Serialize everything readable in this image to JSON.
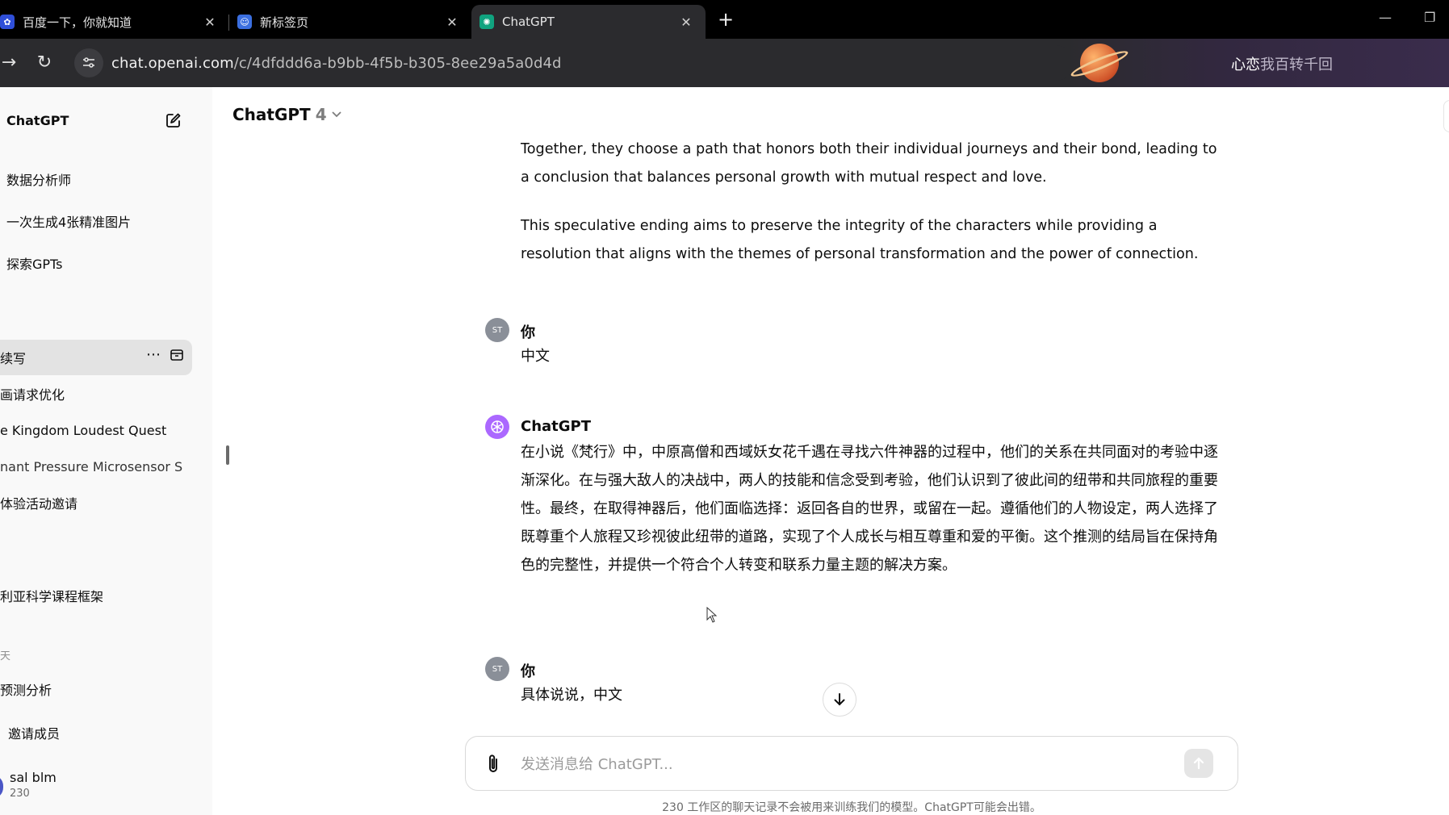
{
  "browser": {
    "tabs": [
      {
        "title": "百度一下，你就知道",
        "icon": "baidu-paw-icon"
      },
      {
        "title": "新标签页",
        "icon": "new-tab-icon"
      },
      {
        "title": "ChatGPT",
        "icon": "chatgpt-logo-icon",
        "active": true
      }
    ],
    "new_tab_label": "+",
    "url_host": "chat.openai.com",
    "url_path": "/c/4dfddd6a-b9bb-4f5b-b305-8ee29a5a0d4d",
    "banner_motto_a": "心恋",
    "banner_motto_b": "我百转千回"
  },
  "sidebar": {
    "title": "ChatGPT",
    "gpts": [
      {
        "label": "数据分析师"
      },
      {
        "label": "一次生成4张精准图片"
      },
      {
        "label": "探索GPTs"
      }
    ],
    "conversations": [
      {
        "label": "续写",
        "active": true
      },
      {
        "label": "画请求优化"
      },
      {
        "label": "e Kingdom Loudest Quest"
      },
      {
        "label": "nant Pressure Microsensor S"
      },
      {
        "label": "体验活动邀请"
      },
      {
        "label": "利亚科学课程框架"
      }
    ],
    "group_label": "天",
    "later": [
      {
        "label": "预测分析"
      }
    ],
    "invite_label": "邀请成员",
    "user": {
      "name": "sal blm",
      "sub": "230"
    }
  },
  "header": {
    "model_name": "ChatGPT",
    "model_version": "4",
    "chevron": "⌄"
  },
  "messages": {
    "assistant_prev": [
      "Together, they choose a path that honors both their individual journeys and their bond, leading to a conclusion that balances personal growth with mutual respect and love.",
      "This speculative ending aims to preserve the integrity of the characters while providing a resolution that aligns with the themes of personal transformation and the power of connection."
    ],
    "user_1": {
      "author": "你",
      "avatar": "ST",
      "text": "中文"
    },
    "assistant_1": {
      "author": "ChatGPT",
      "text": "在小说《梵行》中，中原高僧和西域妖女花千遇在寻找六件神器的过程中，他们的关系在共同面对的考验中逐渐深化。在与强大敌人的决战中，两人的技能和信念受到考验，他们认识到了彼此间的纽带和共同旅程的重要性。最终，在取得神器后，他们面临选择：返回各自的世界，或留在一起。遵循他们的人物设定，两人选择了既尊重个人旅程又珍视彼此纽带的道路，实现了个人成长与相互尊重和爱的平衡。这个推测的结局旨在保持角色的完整性，并提供一个符合个人转变和联系力量主题的解决方案。"
    },
    "user_2": {
      "author": "你",
      "avatar": "ST",
      "text": "具体说说，中文"
    }
  },
  "composer": {
    "placeholder": "发送消息给 ChatGPT...",
    "value": ""
  },
  "footnote": "230 工作区的聊天记录不会被用来训练我们的模型。ChatGPT可能会出错。",
  "colors": {
    "tab_strip": "#000000",
    "address_bar": "#2b2b2e",
    "sidebar_bg": "#f9f9f9",
    "active_conversation": "#e3e3e3",
    "gpt_avatar": "#ab68ff",
    "user_avatar": "#8a8f98"
  }
}
